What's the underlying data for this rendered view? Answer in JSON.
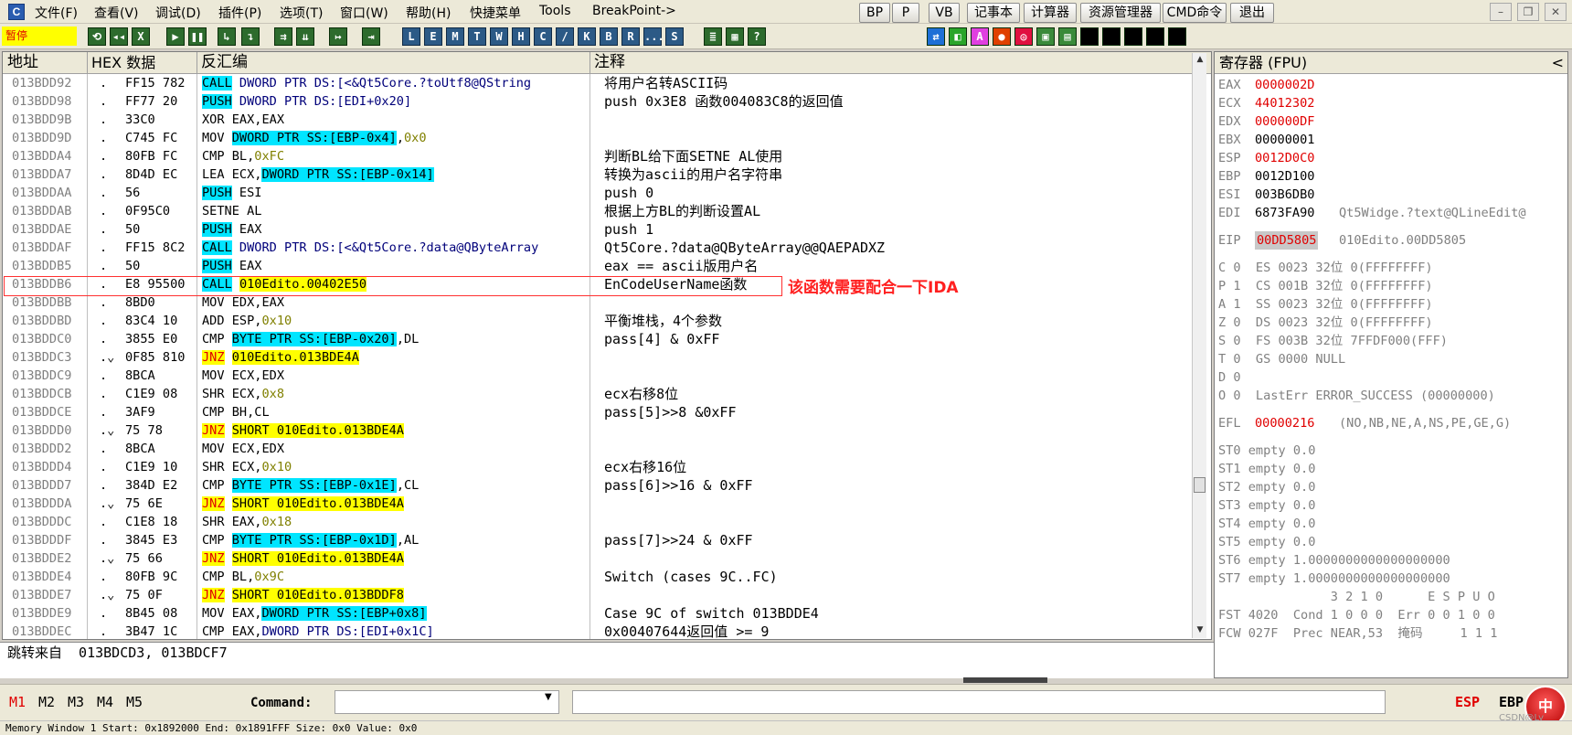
{
  "menu": {
    "app_icon": "C",
    "items": [
      "文件(F)",
      "查看(V)",
      "调试(D)",
      "插件(P)",
      "选项(T)",
      "窗口(W)",
      "帮助(H)",
      "快捷菜单",
      "Tools",
      "BreakPoint->"
    ],
    "right_buttons": [
      "BP",
      "P",
      "VB",
      "记事本",
      "计算器",
      "资源管理器",
      "CMD命令",
      "退出"
    ],
    "window_controls": [
      "–",
      "❐",
      "✕"
    ]
  },
  "toolbar": {
    "status": "暂停",
    "buttons": [
      "⟲",
      "◂◂",
      "X",
      "▶",
      "❚❚",
      "↳",
      "↴",
      "⇉",
      "⇊",
      "↦",
      "⇥",
      "L",
      "E",
      "M",
      "T",
      "W",
      "H",
      "C",
      "/",
      "K",
      "B",
      "R",
      "...",
      "S",
      "≣",
      "▦",
      "?"
    ],
    "plugin_icons": [
      "⇄",
      "◧",
      "A",
      "●",
      "◎",
      "▣",
      "▤",
      "",
      "",
      "",
      "",
      ""
    ]
  },
  "disasm": {
    "headers": [
      "地址",
      "HEX 数据",
      "反汇编",
      "注释"
    ],
    "rows": [
      {
        "addr": "013BDD92",
        "dot": ".",
        "hex": "FF15 782",
        "dis": [
          [
            "call",
            "CALL"
          ],
          [
            "txt",
            " DWORD PTR DS:[<&Qt5Core.?toUtf8@QString"
          ]
        ],
        "comment": "将用户名转ASCII码"
      },
      {
        "addr": "013BDD98",
        "dot": ".",
        "hex": "FF77 20",
        "dis": [
          [
            "call",
            "PUSH"
          ],
          [
            "txt",
            " DWORD PTR DS:[EDI+0x20]"
          ]
        ],
        "comment": "push 0x3E8 函数004083C8的返回值"
      },
      {
        "addr": "013BDD9B",
        "dot": ".",
        "hex": "33C0",
        "dis": [
          [
            "op",
            "XOR EAX,EAX"
          ]
        ],
        "comment": ""
      },
      {
        "addr": "013BDD9D",
        "dot": ".",
        "hex": "C745 FC",
        "dis": [
          [
            "op",
            "MOV "
          ],
          [
            "mem",
            "DWORD PTR SS:[EBP-0x4]"
          ],
          [
            "op",
            ","
          ],
          [
            "num",
            "0x0"
          ]
        ],
        "comment": ""
      },
      {
        "addr": "013BDDA4",
        "dot": ".",
        "hex": "80FB FC",
        "dis": [
          [
            "op",
            "CMP BL,"
          ],
          [
            "num",
            "0xFC"
          ]
        ],
        "comment": "判断BL给下面SETNE AL使用"
      },
      {
        "addr": "013BDDA7",
        "dot": ".",
        "hex": "8D4D EC",
        "dis": [
          [
            "op",
            "LEA ECX,"
          ],
          [
            "mem",
            "DWORD PTR SS:[EBP-0x14]"
          ]
        ],
        "comment": "转换为ascii的用户名字符串"
      },
      {
        "addr": "013BDDAA",
        "dot": ".",
        "hex": "56",
        "dis": [
          [
            "call",
            "PUSH"
          ],
          [
            "op",
            " ESI"
          ]
        ],
        "comment": "push 0"
      },
      {
        "addr": "013BDDAB",
        "dot": ".",
        "hex": "0F95C0",
        "dis": [
          [
            "op",
            "SETNE AL"
          ]
        ],
        "comment": "根据上方BL的判断设置AL"
      },
      {
        "addr": "013BDDAE",
        "dot": ".",
        "hex": "50",
        "dis": [
          [
            "call",
            "PUSH"
          ],
          [
            "op",
            " EAX"
          ]
        ],
        "comment": "push 1"
      },
      {
        "addr": "013BDDAF",
        "dot": ".",
        "hex": "FF15 8C2",
        "dis": [
          [
            "call",
            "CALL"
          ],
          [
            "txt",
            " DWORD PTR DS:[<&Qt5Core.?data@QByteArray"
          ]
        ],
        "comment": "Qt5Core.?data@QByteArray@@QAEPADXZ"
      },
      {
        "addr": "013BDDB5",
        "dot": ".",
        "hex": "50",
        "dis": [
          [
            "call",
            "PUSH"
          ],
          [
            "op",
            " EAX"
          ]
        ],
        "comment": "eax == ascii版用户名"
      },
      {
        "addr": "013BDDB6",
        "dot": ".",
        "hex": "E8 95500",
        "dis": [
          [
            "call",
            "CALL"
          ],
          [
            "op",
            " "
          ],
          [
            "tgt",
            "010Edito.00402E50"
          ]
        ],
        "comment": "EnCodeUserName函数"
      },
      {
        "addr": "013BDDBB",
        "dot": ".",
        "hex": "8BD0",
        "dis": [
          [
            "op",
            "MOV EDX,EAX"
          ]
        ],
        "comment": ""
      },
      {
        "addr": "013BDDBD",
        "dot": ".",
        "hex": "83C4 10",
        "dis": [
          [
            "op",
            "ADD ESP,"
          ],
          [
            "num",
            "0x10"
          ]
        ],
        "comment": "平衡堆栈，4个参数"
      },
      {
        "addr": "013BDDC0",
        "dot": ".",
        "hex": "3855 E0",
        "dis": [
          [
            "op",
            "CMP "
          ],
          [
            "mem",
            "BYTE PTR SS:[EBP-0x20]"
          ],
          [
            "op",
            ",DL"
          ]
        ],
        "comment": "pass[4] & 0xFF"
      },
      {
        "addr": "013BDDC3",
        "dot": ".⌄",
        "hex": "0F85 810",
        "dis": [
          [
            "jmp",
            "JNZ"
          ],
          [
            "op",
            " "
          ],
          [
            "tgt",
            "010Edito.013BDE4A"
          ]
        ],
        "comment": ""
      },
      {
        "addr": "013BDDC9",
        "dot": ".",
        "hex": "8BCA",
        "dis": [
          [
            "op",
            "MOV ECX,EDX"
          ]
        ],
        "comment": ""
      },
      {
        "addr": "013BDDCB",
        "dot": ".",
        "hex": "C1E9 08",
        "dis": [
          [
            "op",
            "SHR ECX,"
          ],
          [
            "num",
            "0x8"
          ]
        ],
        "comment": "ecx右移8位"
      },
      {
        "addr": "013BDDCE",
        "dot": ".",
        "hex": "3AF9",
        "dis": [
          [
            "op",
            "CMP BH,CL"
          ]
        ],
        "comment": "pass[5]>>8 &0xFF"
      },
      {
        "addr": "013BDDD0",
        "dot": ".⌄",
        "hex": "75 78",
        "dis": [
          [
            "jmp",
            "JNZ"
          ],
          [
            "op",
            " "
          ],
          [
            "tgt",
            "SHORT 010Edito.013BDE4A"
          ]
        ],
        "comment": ""
      },
      {
        "addr": "013BDDD2",
        "dot": ".",
        "hex": "8BCA",
        "dis": [
          [
            "op",
            "MOV ECX,EDX"
          ]
        ],
        "comment": ""
      },
      {
        "addr": "013BDDD4",
        "dot": ".",
        "hex": "C1E9 10",
        "dis": [
          [
            "op",
            "SHR ECX,"
          ],
          [
            "num",
            "0x10"
          ]
        ],
        "comment": "ecx右移16位"
      },
      {
        "addr": "013BDDD7",
        "dot": ".",
        "hex": "384D E2",
        "dis": [
          [
            "op",
            "CMP "
          ],
          [
            "mem",
            "BYTE PTR SS:[EBP-0x1E]"
          ],
          [
            "op",
            ",CL"
          ]
        ],
        "comment": "pass[6]>>16 & 0xFF"
      },
      {
        "addr": "013BDDDA",
        "dot": ".⌄",
        "hex": "75 6E",
        "dis": [
          [
            "jmp",
            "JNZ"
          ],
          [
            "op",
            " "
          ],
          [
            "tgt",
            "SHORT 010Edito.013BDE4A"
          ]
        ],
        "comment": ""
      },
      {
        "addr": "013BDDDC",
        "dot": ".",
        "hex": "C1E8 18",
        "dis": [
          [
            "op",
            "SHR EAX,"
          ],
          [
            "num",
            "0x18"
          ]
        ],
        "comment": ""
      },
      {
        "addr": "013BDDDF",
        "dot": ".",
        "hex": "3845 E3",
        "dis": [
          [
            "op",
            "CMP "
          ],
          [
            "mem",
            "BYTE PTR SS:[EBP-0x1D]"
          ],
          [
            "op",
            ",AL"
          ]
        ],
        "comment": "pass[7]>>24 & 0xFF"
      },
      {
        "addr": "013BDDE2",
        "dot": ".⌄",
        "hex": "75 66",
        "dis": [
          [
            "jmp",
            "JNZ"
          ],
          [
            "op",
            " "
          ],
          [
            "tgt",
            "SHORT 010Edito.013BDE4A"
          ]
        ],
        "comment": ""
      },
      {
        "addr": "013BDDE4",
        "dot": ".",
        "hex": "80FB 9C",
        "dis": [
          [
            "op",
            "CMP BL,"
          ],
          [
            "num",
            "0x9C"
          ]
        ],
        "comment": "Switch (cases 9C..FC)"
      },
      {
        "addr": "013BDDE7",
        "dot": ".⌄",
        "hex": "75 0F",
        "dis": [
          [
            "jmp",
            "JNZ"
          ],
          [
            "op",
            " "
          ],
          [
            "tgt",
            "SHORT 010Edito.013BDDF8"
          ]
        ],
        "comment": ""
      },
      {
        "addr": "013BDDE9",
        "dot": ".",
        "hex": "8B45 08",
        "dis": [
          [
            "op",
            "MOV EAX,"
          ],
          [
            "mem",
            "DWORD PTR SS:[EBP+0x8]"
          ]
        ],
        "comment": "Case 9C of switch 013BDDE4"
      },
      {
        "addr": "013BDDEC",
        "dot": ".",
        "hex": "3B47 1C",
        "dis": [
          [
            "op",
            "CMP EAX,"
          ],
          [
            "txt",
            "DWORD PTR DS:[EDI+0x1C]"
          ]
        ],
        "comment": "0x00407644返回值 >= 9"
      }
    ],
    "selected_index": 11,
    "annotation": "该函数需要配合一下IDA",
    "jump_from": "跳转来自  013BDCD3, 013BDCF7"
  },
  "registers": {
    "header": "寄存器 (FPU)",
    "collapse": "<",
    "gp": [
      {
        "name": "EAX",
        "value": "0000002D",
        "changed": true,
        "extra": ""
      },
      {
        "name": "ECX",
        "value": "44012302",
        "changed": true,
        "extra": ""
      },
      {
        "name": "EDX",
        "value": "000000DF",
        "changed": true,
        "extra": ""
      },
      {
        "name": "EBX",
        "value": "00000001",
        "changed": false,
        "extra": ""
      },
      {
        "name": "ESP",
        "value": "0012D0C0",
        "changed": true,
        "extra": ""
      },
      {
        "name": "EBP",
        "value": "0012D100",
        "changed": false,
        "extra": ""
      },
      {
        "name": "ESI",
        "value": "003B6DB0",
        "changed": false,
        "extra": ""
      },
      {
        "name": "EDI",
        "value": "6873FA90",
        "changed": false,
        "extra": "Qt5Widge.?text@QLineEdit@"
      }
    ],
    "eip": {
      "name": "EIP",
      "value": "00DD5805",
      "extra": "010Edito.00DD5805"
    },
    "flags": [
      "C 0  ES 0023 32位 0(FFFFFFFF)",
      "P 1  CS 001B 32位 0(FFFFFFFF)",
      "A 1  SS 0023 32位 0(FFFFFFFF)",
      "Z 0  DS 0023 32位 0(FFFFFFFF)",
      "S 0  FS 003B 32位 7FFDF000(FFF)",
      "T 0  GS 0000 NULL",
      "D 0",
      "O 0  LastErr ERROR_SUCCESS (00000000)"
    ],
    "efl": {
      "name": "EFL",
      "value": "00000216",
      "extra": "(NO,NB,NE,A,NS,PE,GE,G)"
    },
    "fpu": [
      "ST0 empty 0.0",
      "ST1 empty 0.0",
      "ST2 empty 0.0",
      "ST3 empty 0.0",
      "ST4 empty 0.0",
      "ST5 empty 0.0",
      "ST6 empty 1.0000000000000000000",
      "ST7 empty 1.0000000000000000000"
    ],
    "fpu_bits": "               3 2 1 0      E S P U O",
    "fst": "FST 4020  Cond 1 0 0 0  Err 0 0 1 0 0",
    "fcw": "FCW 027F  Prec NEAR,53  掩码     1 1 1"
  },
  "status": {
    "mem_tabs": [
      "M1",
      "M2",
      "M3",
      "M4",
      "M5"
    ],
    "active_tab": 0,
    "command_label": "Command:",
    "command_value": "",
    "esp_label": "ESP",
    "ebp_label": "EBP",
    "badge": "中",
    "watermark": "CSDN@Ly",
    "memory_window": "Memory Window 1  Start: 0x1892000  End: 0x1891FFF  Size: 0x0 Value: 0x0"
  },
  "colors": {
    "changed_reg": "#e00000",
    "jump_bg": "#ffff00",
    "call_bg": "#00e5ff",
    "annotation": "#ff2020",
    "address": "#808080"
  }
}
